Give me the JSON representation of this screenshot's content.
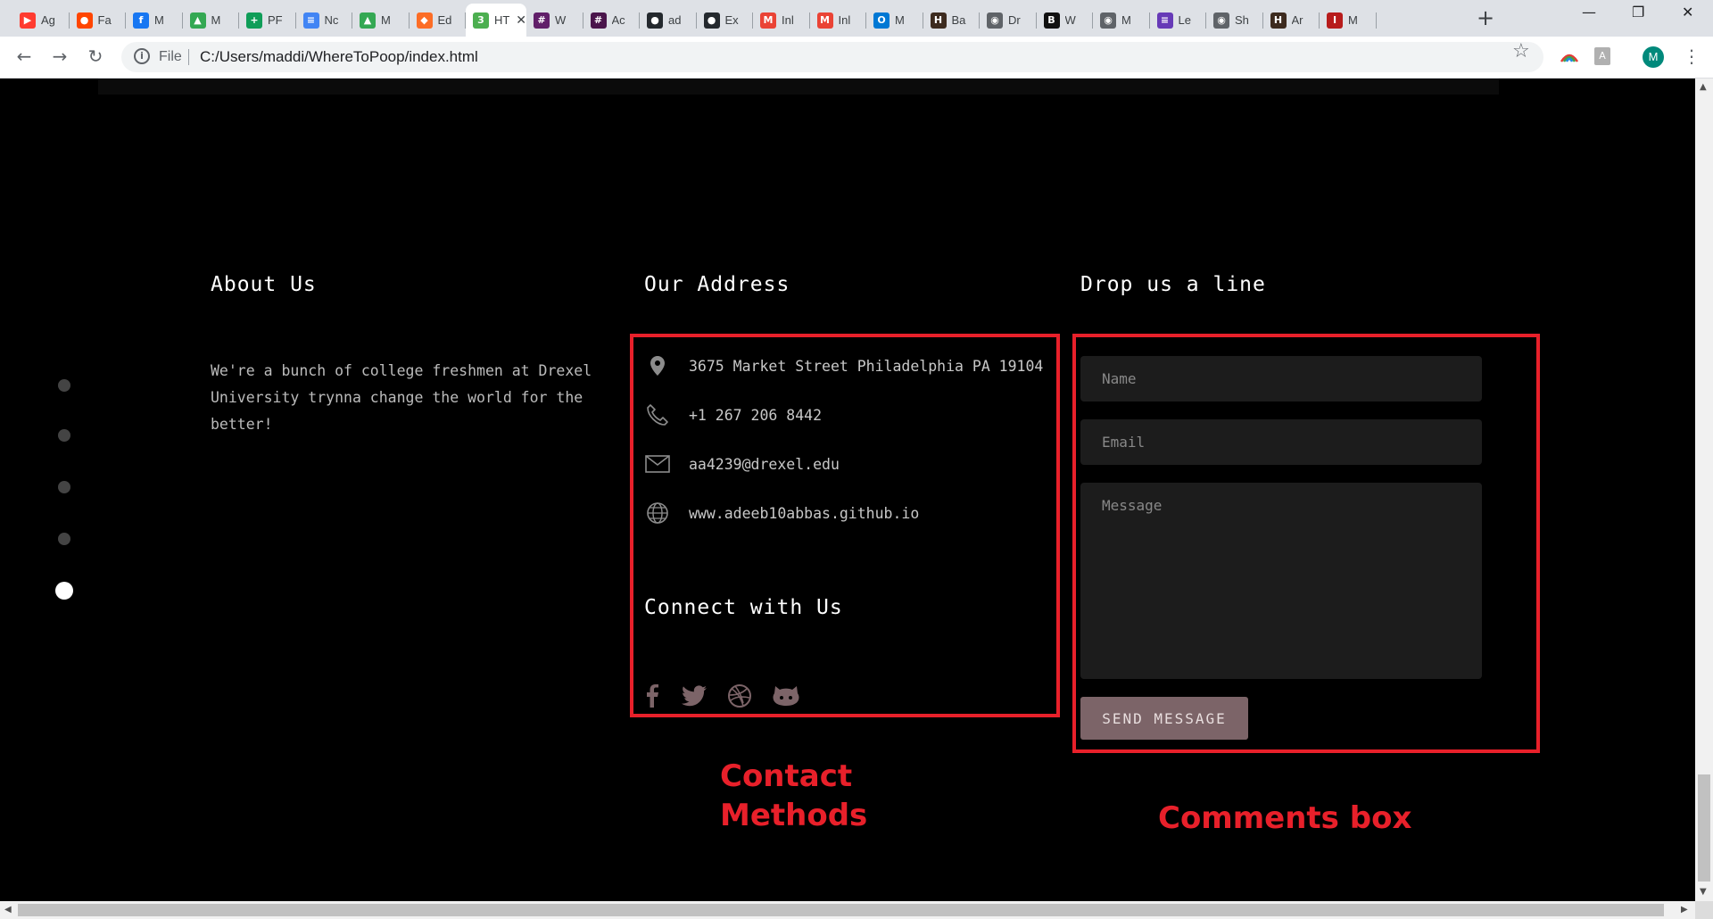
{
  "browser": {
    "tabs": [
      {
        "title": "Ag",
        "color": "#ff3b30",
        "glyph": "▶",
        "icon": "youtube-icon"
      },
      {
        "title": "Fa",
        "color": "#ff4500",
        "glyph": "●",
        "icon": "reddit-icon"
      },
      {
        "title": "M",
        "color": "#1877f2",
        "glyph": "f",
        "icon": "facebook-icon"
      },
      {
        "title": "M",
        "color": "#34a853",
        "glyph": "▲",
        "icon": "drive-icon"
      },
      {
        "title": "PF",
        "color": "#0f9d58",
        "glyph": "+",
        "icon": "sheets-icon"
      },
      {
        "title": "Nc",
        "color": "#4285f4",
        "glyph": "≡",
        "icon": "docs-icon"
      },
      {
        "title": "M",
        "color": "#34a853",
        "glyph": "▲",
        "icon": "drive-icon"
      },
      {
        "title": "Ed",
        "color": "#fc6d26",
        "glyph": "◆",
        "icon": "gitlab-icon"
      },
      {
        "title": "HT",
        "color": "#4caf50",
        "glyph": "3",
        "icon": "w3schools-icon"
      },
      {
        "title": "W",
        "color": "#611f69",
        "glyph": "#",
        "icon": "slack-icon"
      },
      {
        "title": "Ac",
        "color": "#4a154b",
        "glyph": "#",
        "icon": "slack-icon"
      },
      {
        "title": "ad",
        "color": "#24292e",
        "glyph": "●",
        "icon": "github-icon"
      },
      {
        "title": "Ex",
        "color": "#24292e",
        "glyph": "●",
        "icon": "github-icon"
      },
      {
        "title": "Inl",
        "color": "#ea4335",
        "glyph": "M",
        "icon": "gmail-icon"
      },
      {
        "title": "Inl",
        "color": "#ea4335",
        "glyph": "M",
        "icon": "gmail-icon"
      },
      {
        "title": "M",
        "color": "#0078d4",
        "glyph": "O",
        "icon": "outlook-icon"
      },
      {
        "title": "Ba",
        "color": "#3d2b1f",
        "glyph": "H",
        "icon": "drexel-icon"
      },
      {
        "title": "Dr",
        "color": "#5f6368",
        "glyph": "◉",
        "icon": "globe-icon"
      },
      {
        "title": "W",
        "color": "#111111",
        "glyph": "B",
        "icon": "blackboard-icon"
      },
      {
        "title": "M",
        "color": "#5f6368",
        "glyph": "◉",
        "icon": "globe-icon"
      },
      {
        "title": "Le",
        "color": "#673ab7",
        "glyph": "≡",
        "icon": "forms-icon"
      },
      {
        "title": "Sh",
        "color": "#5f6368",
        "glyph": "◉",
        "icon": "globe-icon"
      },
      {
        "title": "Ar",
        "color": "#3d2b1f",
        "glyph": "H",
        "icon": "drexel-icon"
      },
      {
        "title": "M",
        "color": "#b71c1c",
        "glyph": "I",
        "icon": "library-icon"
      }
    ],
    "active_tab_index": 8,
    "address": {
      "scheme": "File",
      "url": "C:/Users/maddi/WhereToPoop/index.html"
    },
    "profile_initial": "M",
    "ext_label": "A"
  },
  "footer": {
    "about": {
      "title": "About Us",
      "text": "We're a bunch of college freshmen at Drexel University trynna change the world for the better!"
    },
    "address": {
      "title": "Our Address",
      "street": "3675 Market Street Philadelphia PA 19104",
      "phone": "+1 267 206 8442",
      "email": "aa4239@drexel.edu",
      "website": "www.adeeb10abbas.github.io"
    },
    "connect": {
      "title": "Connect with Us",
      "networks": [
        "facebook",
        "twitter",
        "dribbble",
        "github"
      ]
    },
    "contact_form": {
      "title": "Drop us a line",
      "name_placeholder": "Name",
      "email_placeholder": "Email",
      "message_placeholder": "Message",
      "send_label": "SEND MESSAGE"
    }
  },
  "section_dots": {
    "count": 5,
    "active_index": 4
  },
  "annotations": {
    "contact_label_line1": "Contact",
    "contact_label_line2": "Methods",
    "comments_label": "Comments box",
    "color": "#e8202a"
  }
}
